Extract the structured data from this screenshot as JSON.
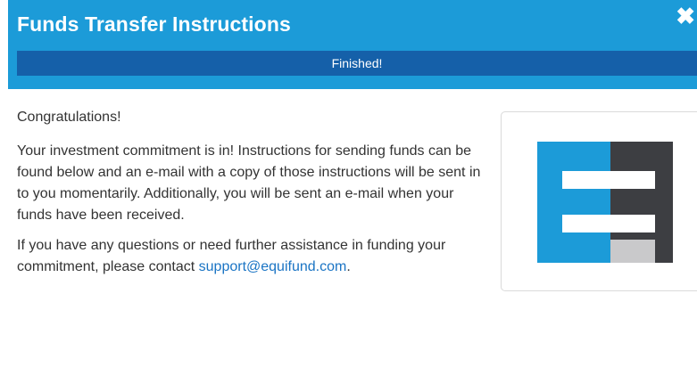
{
  "header": {
    "title": "Funds Transfer Instructions",
    "close_icon": "close-icon"
  },
  "progress": {
    "label": "Finished!",
    "value": 1.0
  },
  "body": {
    "greeting": "Congratulations!",
    "paragraph1": "Your investment commitment is in! Instructions for sending funds can be found below and an e-mail with a copy of those instructions will be sent in to you momentarily. Additionally, you will be sent an e-mail when your funds have been received.",
    "paragraph2_prefix": "If you have any questions or need further assistance in funding your commitment, please contact ",
    "support_email": "support@equifund.com",
    "paragraph2_suffix": "."
  },
  "logo": {
    "name": "equifund-logo",
    "colors": {
      "blue": "#1c9bd8",
      "dark": "#3d3e42",
      "light_gray": "#c9c9cb"
    }
  },
  "colors": {
    "header_bg": "#1c9bd8",
    "progress_fill": "#1560a9",
    "link": "#1a74c4",
    "text": "#333333"
  }
}
